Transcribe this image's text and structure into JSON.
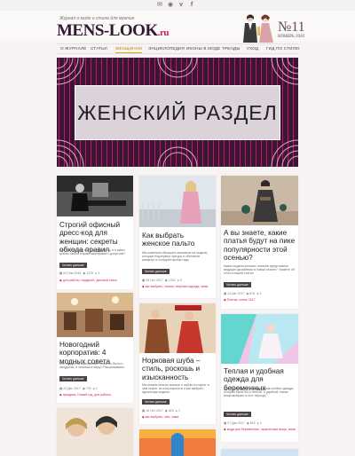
{
  "topbar": {
    "icons": [
      "mail-icon",
      "rss-icon",
      "vk-icon",
      "facebook-icon"
    ]
  },
  "header": {
    "tagline": "Журнал о моде и стиле для мужчин",
    "logo": "MENS-LOOK",
    "logo_suffix": ".ru",
    "issue_number": "№11",
    "issue_date": "НОЯБРЬ 2020"
  },
  "nav": {
    "items": [
      "О журнале",
      "Статьи",
      "Женщинам",
      "Энциклопедия",
      "Иконы в моде",
      "Тренды",
      "Уход",
      "Гид по стилю"
    ],
    "active": "Женщинам"
  },
  "hero": {
    "title": "ЖЕНСКИЙ РАЗДЕЛ"
  },
  "colors": {
    "accent": "#d81b60",
    "hero_bg": "#3a1635",
    "gold": "#d4a900"
  },
  "articles": [
    {
      "title": "Строгий офисный дресс-код для женщин: секреты обхода правил",
      "excerpt": "Как бизнес-леди одеться на работу, и в каких гранях такого образа эксперимент допустим?",
      "more": "Читать дальше",
      "date": "04 Янв 2018",
      "views": "1375",
      "comments": "3",
      "tags": "для работы, гардероб, деловой стиль"
    },
    {
      "title": "Как выбрать женское пальто",
      "excerpt": "Мы советуем обращать внимание на модели, которые подчеркнут фигуру и обеспечат комфорт в холодное время года.",
      "more": "Читать дальше",
      "date": "06 Окт 2017",
      "views": "1224",
      "comments": "3",
      "tags": "как выбрать, пальто, верхняя одежда, зима"
    },
    {
      "title": "А вы знаете, какие платья будут на пике популярности этой осенью?",
      "excerpt": "Какие модели женских платьев представили ведущие дизайнеры в новом сезоне? Узнайте об этом в нашей статье.",
      "more": "Читать дальше",
      "date": "24 Авг 2017",
      "views": "876",
      "comments": "2",
      "tags": "Платья, осень 2017"
    },
    {
      "title": "Новогодний корпоратив: 4 модных совета",
      "excerpt": "Что надеть на корпоратив, чтобы не было и занудства, и эпатажа в меру? Рассказываем.",
      "more": "Читать дальше",
      "date": "22 Дек 2017",
      "views": "729",
      "comments": "2",
      "tags": "праздник, Новый год, для работы"
    },
    {
      "title": "Норковая шуба – стиль, роскошь и изысканность",
      "excerpt": "Мы можем многое сказать о шубах из норки: в чём секрет их популярности и как выбрать идеальную модель.",
      "more": "Читать дальше",
      "date": "16 Окт 2017",
      "views": "803",
      "comments": "2",
      "tags": "как выбрать, мех, зима"
    },
    {
      "title": "Теплая и удобная одежда для беременных",
      "excerpt": "Для беременных женщин нужна особая одежда, которая была бы и тёплой, и удобной. Какие вещи выбрать в этот период?",
      "more": "Читать дальше",
      "date": "07 Дек 2017",
      "views": "815",
      "comments": "2",
      "tags": "мода для беременных, практичные вещи, зима"
    }
  ]
}
